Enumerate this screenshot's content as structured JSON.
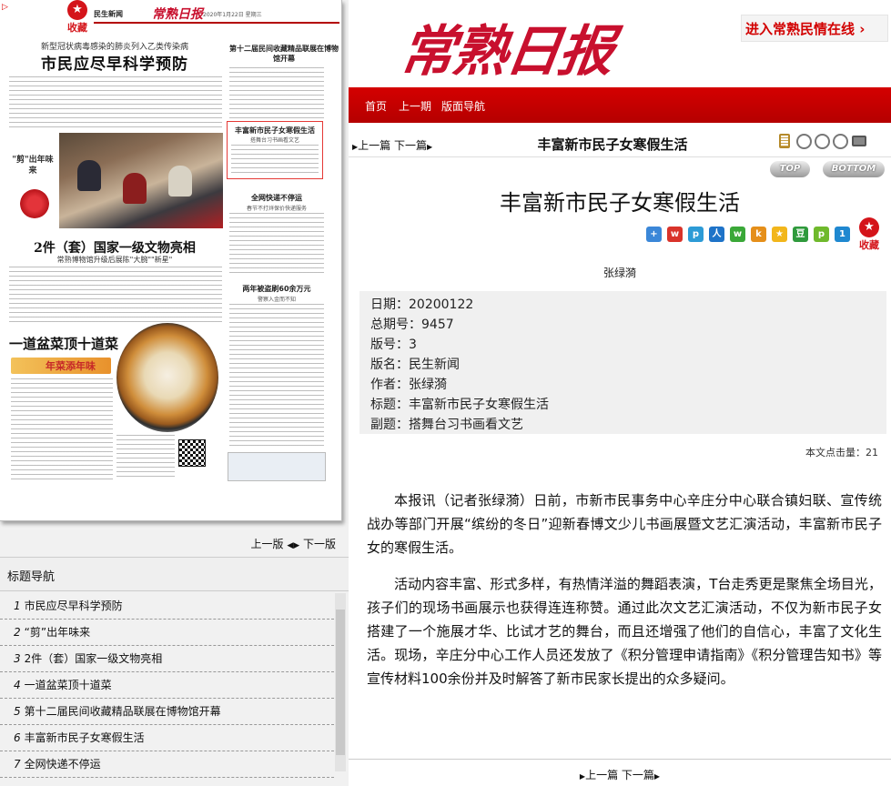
{
  "thumb": {
    "fav_label": "收藏",
    "section_label": "民生新闻",
    "logo_text": "常熟日报",
    "date_text": "2020年1月22日 星期三",
    "headline_sub": "新型冠状病毒感染的肺炎列入乙类传染病",
    "headline": "市民应尽早科学预防",
    "side_title": "第十二届民间收藏精品联展在博物馆开幕",
    "highlight_title": "丰富新市民子女寒假生活",
    "highlight_sub": "搭舞台习书画看文艺",
    "side_title2": "全网快递不停运",
    "side_sub2": "春节不打烊保价快递服务",
    "side_title3": "两年被盗刷60余万元",
    "side_sub3": "警察入金而不知",
    "cut_title": "\"剪\"出年味来",
    "h2": "2件（套）国家一级文物亮相",
    "h2_sub": "常熟博物馆升级后展陈\"大腕\"\"新星\"",
    "h3": "一道盆菜顶十道菜",
    "banner_text": "年菜添年味"
  },
  "thumb_nav": {
    "prev": "上一版",
    "next": "下一版"
  },
  "toc": {
    "heading": "标题导航",
    "items": [
      {
        "num": "1",
        "title": "市民应尽早科学预防"
      },
      {
        "num": "2",
        "title": "“剪”出年味来"
      },
      {
        "num": "3",
        "title": "2件（套）国家一级文物亮相"
      },
      {
        "num": "4",
        "title": "一道盆菜顶十道菜"
      },
      {
        "num": "5",
        "title": "第十二届民间收藏精品联展在博物馆开幕"
      },
      {
        "num": "6",
        "title": "丰富新市民子女寒假生活"
      },
      {
        "num": "7",
        "title": "全网快递不停运"
      }
    ]
  },
  "masthead": {
    "logo": "常熟日报",
    "link": "进入常熟民情在线 ›"
  },
  "topnav": {
    "home": "首页",
    "prev": "上一期",
    "layout": "版面导航"
  },
  "article_bar": {
    "prev": "上一篇",
    "next": "下一篇",
    "title": "丰富新市民子女寒假生活"
  },
  "pills": {
    "top": "TOP",
    "bottom": "BOTTOM"
  },
  "article": {
    "title": "丰富新市民子女寒假生活",
    "author": "张绿漪",
    "fav_label": "收藏",
    "meta": [
      {
        "label": "日期",
        "value": "20200122"
      },
      {
        "label": "总期号",
        "value": "9457"
      },
      {
        "label": "版号",
        "value": "3"
      },
      {
        "label": "版名",
        "value": "民生新闻"
      },
      {
        "label": "作者",
        "value": "张绿漪"
      },
      {
        "label": "标题",
        "value": "丰富新市民子女寒假生活"
      },
      {
        "label": "副题",
        "value": "搭舞台习书画看文艺"
      }
    ],
    "hits_label": "本文点击量：",
    "hits": "21",
    "paragraphs": [
      "本报讯（记者张绿漪）日前，市新市民事务中心辛庄分中心联合镇妇联、宣传统战办等部门开展“缤纷的冬日”迎新春博文少儿书画展暨文艺汇演活动，丰富新市民子女的寒假生活。",
      "活动内容丰富、形式多样，有热情洋溢的舞蹈表演，T台走秀更是聚焦全场目光，孩子们的现场书画展示也获得连连称赞。通过此次文艺汇演活动，不仅为新市民子女搭建了一个施展才华、比试才艺的舞台，而且还增强了他们的自信心，丰富了文化生活。现场，辛庄分中心工作人员还发放了《积分管理申请指南》《积分管理告知书》等宣传材料100余份并及时解答了新市民家长提出的众多疑问。"
    ]
  },
  "bottom_nav": {
    "prev": "上一篇",
    "next": "下一篇"
  },
  "colors": {
    "brand_red": "#c8102e",
    "nav_red": "#c40000"
  }
}
